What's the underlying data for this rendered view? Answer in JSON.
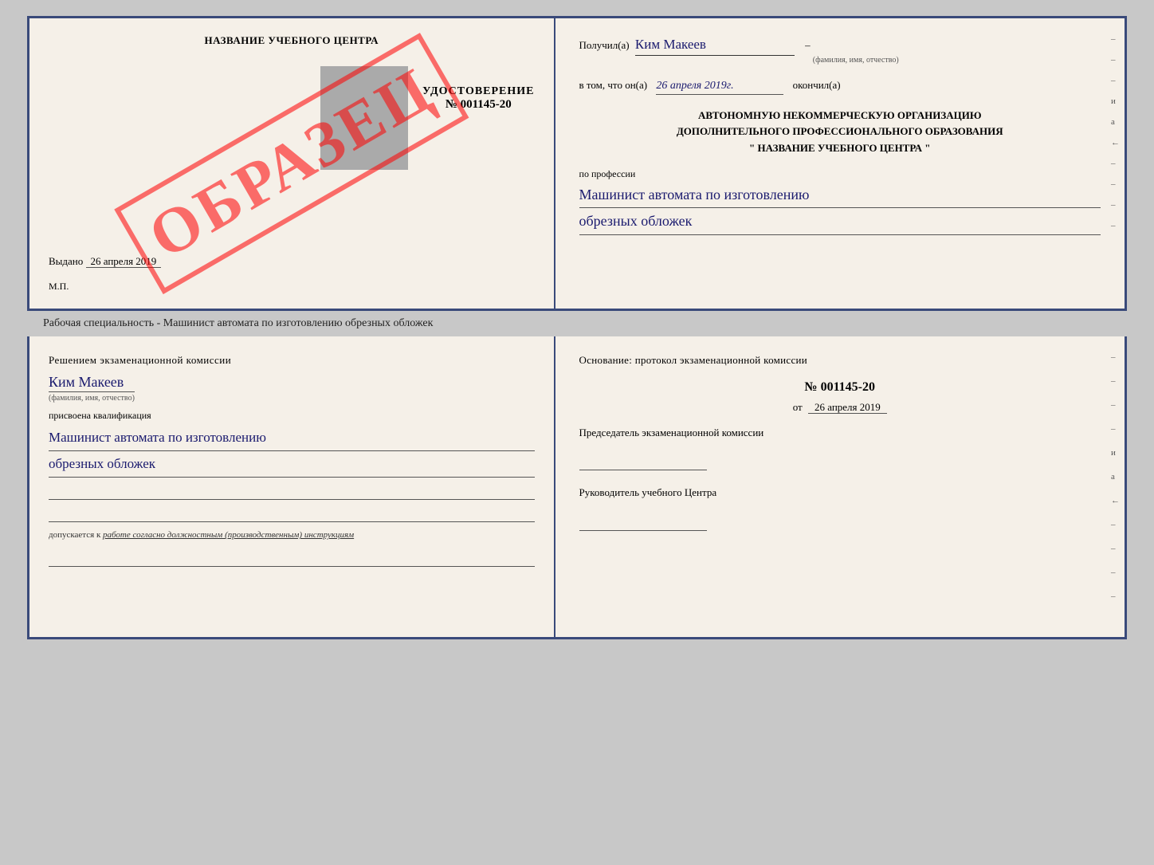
{
  "page": {
    "background": "#c8c8c8"
  },
  "specialty_label": "Рабочая специальность - Машинист автомата по изготовлению обрезных обложек",
  "cert_top": {
    "left": {
      "school_name": "НАЗВАНИЕ УЧЕБНОГО ЦЕНТРА",
      "watermark": "ОБРАЗЕЦ",
      "udostoverenie": "УДОСТОВЕРЕНИЕ",
      "number": "№ 001145-20",
      "vydano_label": "Выдано",
      "vydano_date": "26 апреля 2019",
      "mp": "М.П."
    },
    "right": {
      "poluchil_label": "Получил(а)",
      "recipient_name": "Ким Макеев",
      "fio_caption": "(фамилия, имя, отчество)",
      "vtom_label": "в том, что он(а)",
      "date_field": "26 апреля 2019г.",
      "okonchil_label": "окончил(а)",
      "org_line1": "АВТОНОМНУЮ НЕКОММЕРЧЕСКУЮ ОРГАНИЗАЦИЮ",
      "org_line2": "ДОПОЛНИТЕЛЬНОГО ПРОФЕССИОНАЛЬНОГО ОБРАЗОВАНИЯ",
      "org_name": "\"  НАЗВАНИЕ УЧЕБНОГО ЦЕНТРА  \"",
      "po_professii": "по профессии",
      "profession_line1": "Машинист автомата по изготовлению",
      "profession_line2": "обрезных обложек",
      "side_marks": [
        "–",
        "–",
        "–",
        "и",
        "а",
        "←",
        "–",
        "–",
        "–",
        "–"
      ]
    }
  },
  "cert_bottom": {
    "left": {
      "resheniem_text": "Решением экзаменационной комиссии",
      "name": "Ким Макеев",
      "fio_caption": "(фамилия, имя, отчество)",
      "prisvoena": "присвоена квалификация",
      "qualification_line1": "Машинист автомата по изготовлению",
      "qualification_line2": "обрезных обложек",
      "dopuskaetsya": "допускается к",
      "dopusk_text": "работе согласно должностным (производственным) инструкциям"
    },
    "right": {
      "osnovanie_label": "Основание: протокол экзаменационной комиссии",
      "protocol_number": "№ 001145-20",
      "ot_label": "от",
      "ot_date": "26 апреля 2019",
      "predsedatel_label": "Председатель экзаменационной комиссии",
      "rukovoditel_label": "Руководитель учебного Центра",
      "side_marks": [
        "–",
        "–",
        "–",
        "–",
        "и",
        "а",
        "←",
        "–",
        "–",
        "–",
        "–"
      ]
    }
  }
}
